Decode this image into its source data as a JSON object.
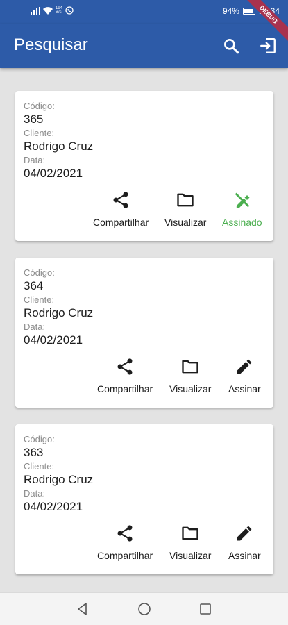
{
  "status_bar": {
    "battery": "94%",
    "time": "13:34",
    "net_top": "194",
    "net_bottom": "B/s",
    "battery_level": 0.94
  },
  "app_bar": {
    "title": "Pesquisar",
    "search_icon": "search-icon",
    "logout_icon": "exit-icon",
    "color": "#2d5ba8"
  },
  "debug_banner": "DEBUG",
  "records": [
    {
      "code_label": "Código:",
      "code": "365",
      "client_label": "Cliente:",
      "client": "Rodrigo Cruz",
      "date_label": "Data:",
      "date": "04/02/2021",
      "share_label": "Compartilhar",
      "view_label": "Visualizar",
      "sign_label": "Assinado",
      "signed": true
    },
    {
      "code_label": "Código:",
      "code": "364",
      "client_label": "Cliente:",
      "client": "Rodrigo Cruz",
      "date_label": "Data:",
      "date": "04/02/2021",
      "share_label": "Compartilhar",
      "view_label": "Visualizar",
      "sign_label": "Assinar",
      "signed": false
    },
    {
      "code_label": "Código:",
      "code": "363",
      "client_label": "Cliente:",
      "client": "Rodrigo Cruz",
      "date_label": "Data:",
      "date": "04/02/2021",
      "share_label": "Compartilhar",
      "view_label": "Visualizar",
      "sign_label": "Assinar",
      "signed": false
    }
  ],
  "signed_color": "#4caf50"
}
